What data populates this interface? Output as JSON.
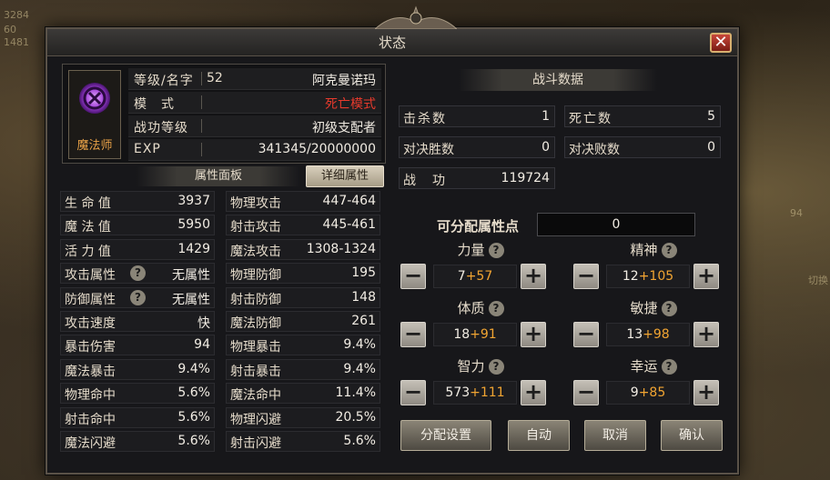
{
  "window": {
    "title": "状态"
  },
  "profile": {
    "class_label": "魔法师",
    "rows": [
      {
        "label": "等级/名字",
        "level": "52",
        "value": "阿克曼诺玛"
      },
      {
        "label": "模　式",
        "level": "",
        "value": "死亡模式"
      },
      {
        "label": "战功等级",
        "level": "",
        "value": "初级支配者"
      },
      {
        "label": "EXP",
        "level": "",
        "value": "341345/20000000"
      }
    ]
  },
  "tabs": {
    "attributes": "属性面板",
    "details": "详细属性"
  },
  "stats_left": [
    {
      "label": "生 命 值",
      "value": "3937"
    },
    {
      "label": "魔 法 值",
      "value": "5950"
    },
    {
      "label": "活 力 值",
      "value": "1429"
    },
    {
      "label": "攻击属性",
      "value": "无属性"
    },
    {
      "label": "防御属性",
      "value": "无属性"
    },
    {
      "label": "攻击速度",
      "value": "快"
    },
    {
      "label": "暴击伤害",
      "value": "94"
    },
    {
      "label": "魔法暴击",
      "value": "9.4%"
    },
    {
      "label": "物理命中",
      "value": "5.6%"
    },
    {
      "label": "射击命中",
      "value": "5.6%"
    },
    {
      "label": "魔法闪避",
      "value": "5.6%"
    }
  ],
  "stats_right": [
    {
      "label": "物理攻击",
      "value": "447-464"
    },
    {
      "label": "射击攻击",
      "value": "445-461"
    },
    {
      "label": "魔法攻击",
      "value": "1308-1324"
    },
    {
      "label": "物理防御",
      "value": "195"
    },
    {
      "label": "射击防御",
      "value": "148"
    },
    {
      "label": "魔法防御",
      "value": "261"
    },
    {
      "label": "物理暴击",
      "value": "9.4%"
    },
    {
      "label": "射击暴击",
      "value": "9.4%"
    },
    {
      "label": "魔法命中",
      "value": "11.4%"
    },
    {
      "label": "物理闪避",
      "value": "20.5%"
    },
    {
      "label": "射击闪避",
      "value": "5.6%"
    }
  ],
  "battle": {
    "header": "战斗数据",
    "kills_label": "击杀数",
    "kills": "1",
    "deaths_label": "死亡数",
    "deaths": "5",
    "duel_wins_label": "对决胜数",
    "duel_wins": "0",
    "duel_losses_label": "对决败数",
    "duel_losses": "0",
    "merit_label": "战　功",
    "merit": "119724"
  },
  "allocation": {
    "points_label": "可分配属性点",
    "points": "0",
    "minus": "−",
    "plus": "+",
    "help": "?",
    "attrs": [
      {
        "name": "力量",
        "base": "7",
        "bonus": "+57"
      },
      {
        "name": "精神",
        "base": "12",
        "bonus": "+105"
      },
      {
        "name": "体质",
        "base": "18",
        "bonus": "+91"
      },
      {
        "name": "敏捷",
        "base": "13",
        "bonus": "+98"
      },
      {
        "name": "智力",
        "base": "573",
        "bonus": "+111"
      },
      {
        "name": "幸运",
        "base": "9",
        "bonus": "+85"
      }
    ]
  },
  "actions": {
    "settings": "分配设置",
    "auto": "自动",
    "cancel": "取消",
    "confirm": "确认"
  },
  "background_hud": {
    "left_texts": [
      "3284",
      "60",
      "1481"
    ],
    "right_texts": [
      "94",
      "切换"
    ]
  },
  "colors": {
    "window_bg": "#17171a",
    "mode_red": "#e83a2c",
    "bonus_orange": "#f2a532",
    "class_orange": "#e9a247",
    "close_red": "#c9473a"
  }
}
